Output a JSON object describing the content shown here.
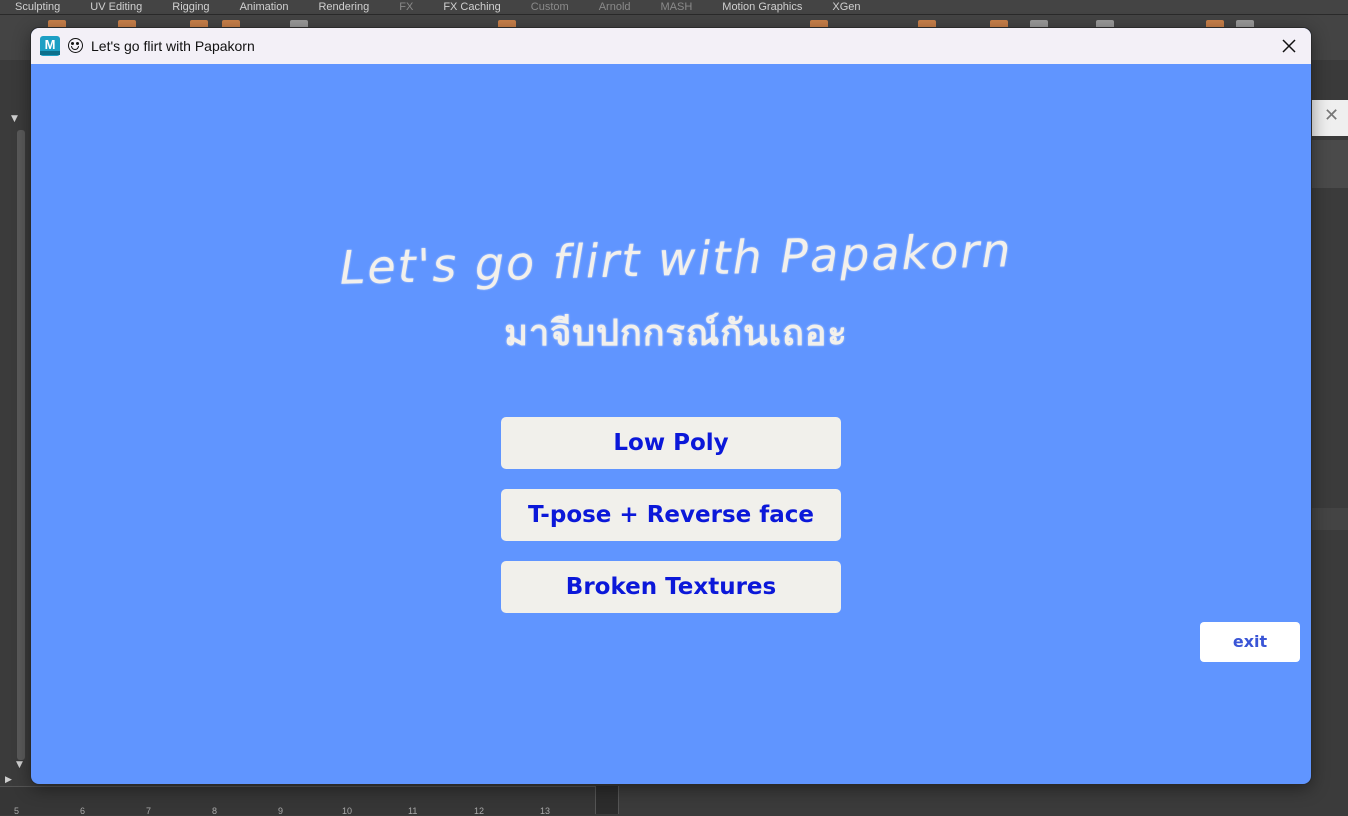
{
  "background": {
    "shelf_tabs": [
      {
        "label": "Sculpting",
        "dim": false
      },
      {
        "label": "UV Editing",
        "dim": false
      },
      {
        "label": "Rigging",
        "dim": false
      },
      {
        "label": "Animation",
        "dim": false
      },
      {
        "label": "Rendering",
        "dim": false
      },
      {
        "label": "FX",
        "dim": true
      },
      {
        "label": "FX Caching",
        "dim": false
      },
      {
        "label": "Custom",
        "dim": true
      },
      {
        "label": "Arnold",
        "dim": true
      },
      {
        "label": "MASH",
        "dim": true
      },
      {
        "label": "Motion Graphics",
        "dim": false
      },
      {
        "label": "XGen",
        "dim": false
      }
    ],
    "timeline_numbers": [
      "5",
      "6",
      "7",
      "8",
      "9",
      "10",
      "11",
      "12",
      "13"
    ]
  },
  "window": {
    "title": "Let's go flirt with Papakorn",
    "app_icon_letter": "M",
    "title_icon": "smiley-face-icon",
    "close_icon": "close-icon"
  },
  "banner": {
    "line1": "Let's go flirt with Papakorn",
    "line2": "มาจีบปกกรณ์กันเถอะ"
  },
  "menu": {
    "buttons": [
      {
        "label": "Low Poly"
      },
      {
        "label": "T-pose + Reverse face"
      },
      {
        "label": "Broken Textures"
      }
    ],
    "exit_label": "exit"
  },
  "colors": {
    "dialog_background": "#6095ff",
    "button_background": "#f1f0eb",
    "button_text": "#0b18d9",
    "exit_text": "#3a55d6",
    "maya_background": "#3b3b3b"
  }
}
